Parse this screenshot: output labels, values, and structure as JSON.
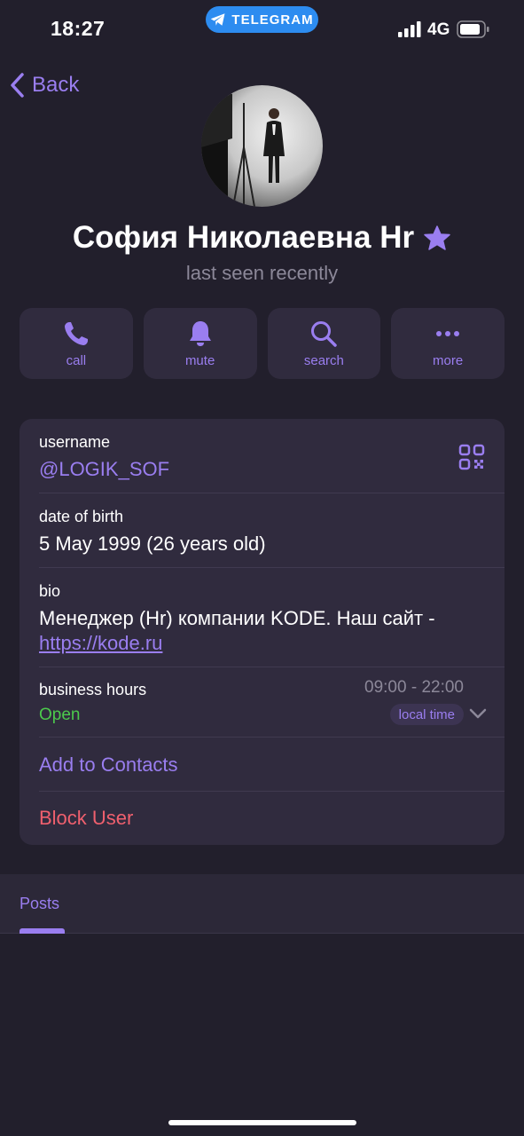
{
  "status_bar": {
    "time": "18:27",
    "app_pill": "TELEGRAM",
    "network": "4G"
  },
  "nav": {
    "back_label": "Back"
  },
  "profile": {
    "name": "София Николаевна Hr",
    "status": "last seen recently",
    "premium_icon": "star-icon"
  },
  "actions": [
    {
      "label": "call",
      "icon": "phone-icon"
    },
    {
      "label": "mute",
      "icon": "bell-icon"
    },
    {
      "label": "search",
      "icon": "search-icon"
    },
    {
      "label": "more",
      "icon": "more-icon"
    }
  ],
  "info": {
    "username_label": "username",
    "username_value": "@LOGIK_SOF",
    "dob_label": "date of birth",
    "dob_value": "5 May 1999 (26 years old)",
    "bio_label": "bio",
    "bio_text": "Менеджер (Hr) компании KODE. Наш сайт -",
    "bio_link": "https://kode.ru",
    "hours_label": "business hours",
    "hours_status": "Open",
    "hours_time": "09:00 - 22:00",
    "hours_badge": "local time",
    "add_contacts": "Add to Contacts",
    "block_user": "Block User"
  },
  "tabs": {
    "posts": "Posts"
  },
  "colors": {
    "background": "#221f2c",
    "card": "#302b3e",
    "accent": "#9a7ef0",
    "open": "#4cc94c",
    "danger": "#f0606e",
    "secondary_text": "#8c8899"
  }
}
